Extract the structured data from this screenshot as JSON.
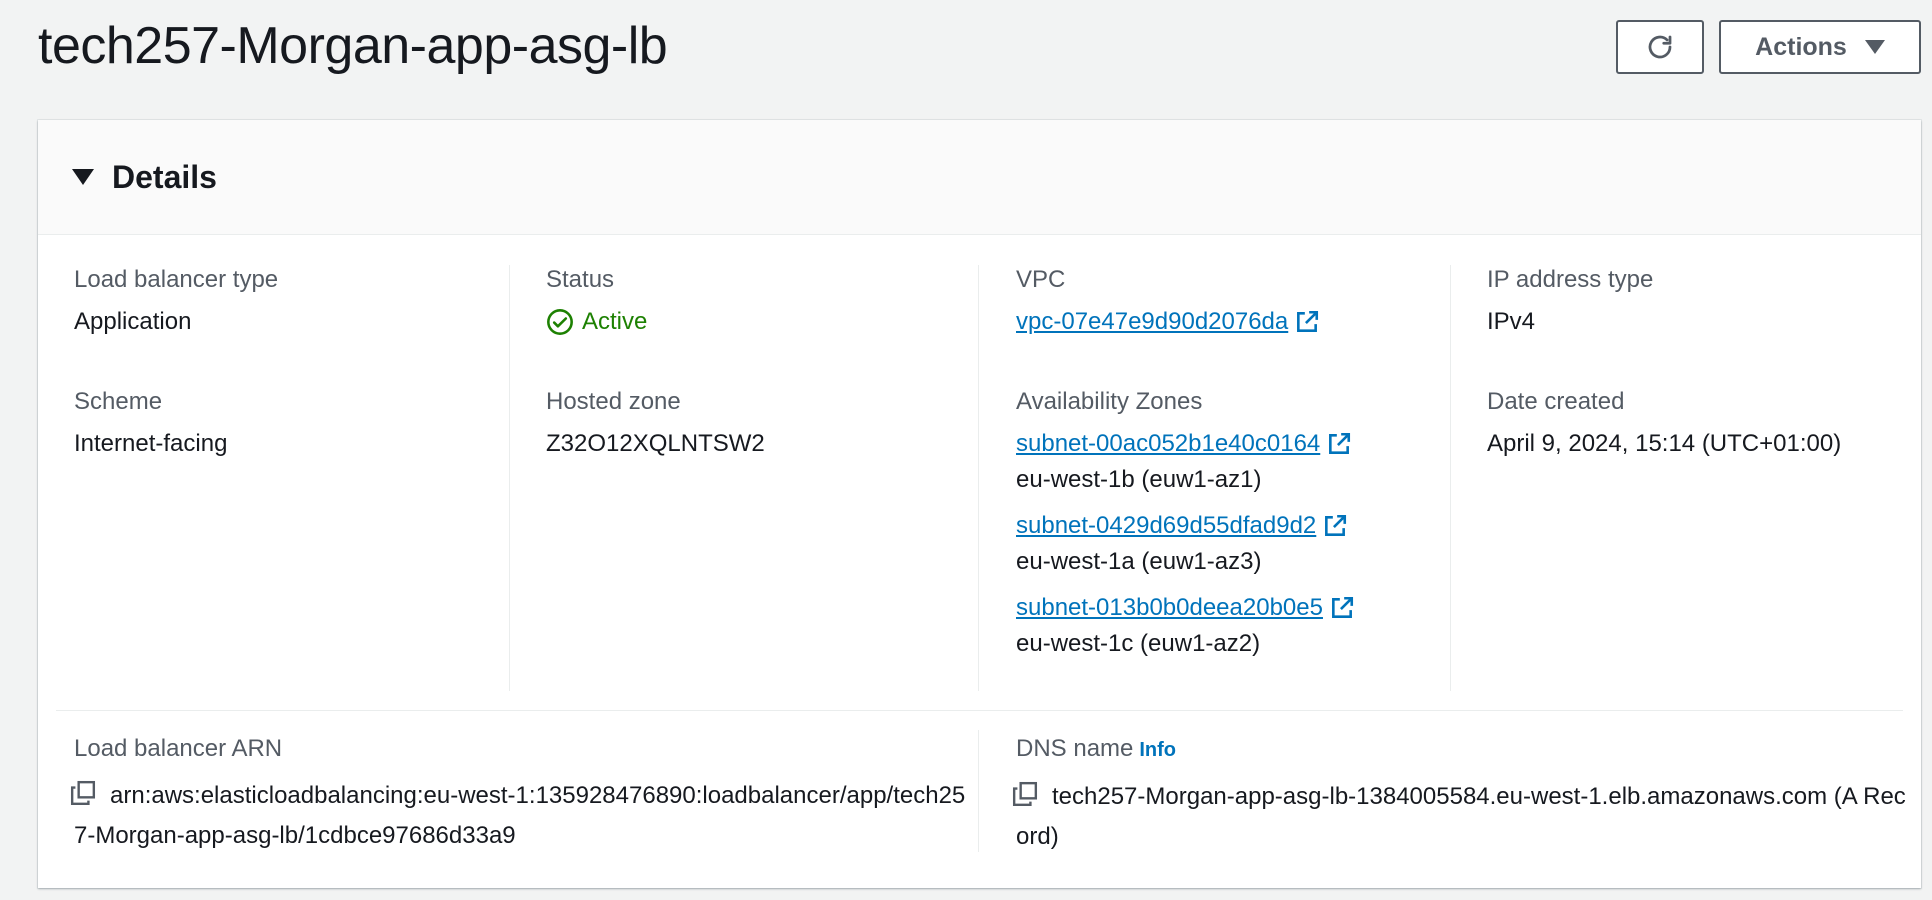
{
  "header": {
    "title": "tech257-Morgan-app-asg-lb",
    "refresh_icon": "refresh-icon",
    "actions_label": "Actions"
  },
  "panel": {
    "title": "Details"
  },
  "details": {
    "lb_type": {
      "label": "Load balancer type",
      "value": "Application"
    },
    "scheme": {
      "label": "Scheme",
      "value": "Internet-facing"
    },
    "status": {
      "label": "Status",
      "value": "Active",
      "color": "#1d8102"
    },
    "hosted_zone": {
      "label": "Hosted zone",
      "value": "Z32O12XQLNTSW2"
    },
    "vpc": {
      "label": "VPC",
      "value": "vpc-07e47e9d90d2076da"
    },
    "availability_zones": {
      "label": "Availability Zones",
      "subnets": [
        {
          "id": "subnet-00ac052b1e40c0164",
          "zone": "eu-west-1b (euw1-az1)"
        },
        {
          "id": "subnet-0429d69d55dfad9d2",
          "zone": "eu-west-1a (euw1-az3)"
        },
        {
          "id": "subnet-013b0b0deea20b0e5",
          "zone": "eu-west-1c (euw1-az2)"
        }
      ]
    },
    "ip_type": {
      "label": "IP address type",
      "value": "IPv4"
    },
    "date_created": {
      "label": "Date created",
      "value": "April 9, 2024, 15:14 (UTC+01:00)"
    },
    "arn": {
      "label": "Load balancer ARN",
      "value": "arn:aws:elasticloadbalancing:eu-west-1:135928476890:loadbalancer/app/tech257-Morgan-app-asg-lb/1cdbce97686d33a9"
    },
    "dns": {
      "label": "DNS name",
      "info": "Info",
      "value": "tech257-Morgan-app-asg-lb-1384005584.eu-west-1.elb.amazonaws.com (A Record)"
    }
  },
  "colors": {
    "link": "#0073bb",
    "active": "#1d8102",
    "text": "#16191f",
    "muted": "#545b64"
  }
}
